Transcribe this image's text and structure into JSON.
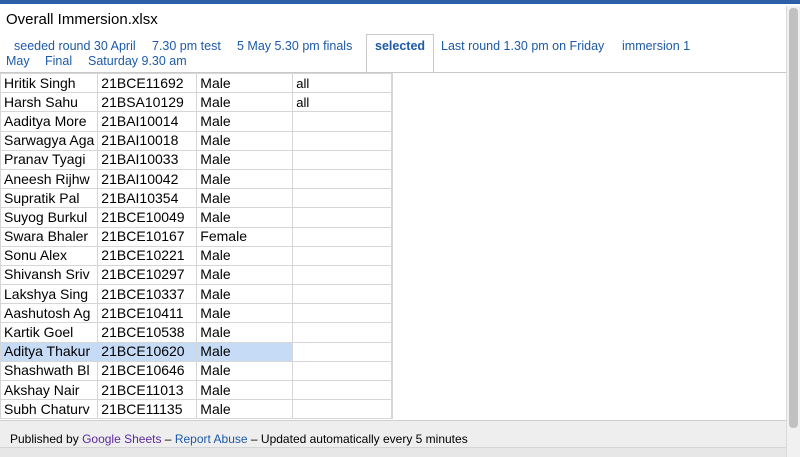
{
  "document": {
    "title": "Overall Immersion.xlsx"
  },
  "tabs": [
    {
      "label": "seeded round 30 April",
      "selected": false
    },
    {
      "label": "7.30 pm test",
      "selected": false
    },
    {
      "label": "5 May 5.30 pm finals",
      "selected": false
    },
    {
      "label": "selected",
      "selected": true
    },
    {
      "label": "Last round 1.30 pm on Friday",
      "selected": false
    },
    {
      "label": "immersion 1",
      "selected": false
    },
    {
      "label": "May",
      "selected": false
    },
    {
      "label": "Final",
      "selected": false
    },
    {
      "label": "Saturday 9.30 am",
      "selected": false
    }
  ],
  "rows": [
    {
      "name": "Hritik Singh",
      "id": "21BCE11692",
      "gender": "Male",
      "note": "all"
    },
    {
      "name": "Harsh Sahu",
      "id": "21BSA10129",
      "gender": "Male",
      "note": "all"
    },
    {
      "name": "Aaditya More",
      "id": "21BAI10014",
      "gender": "Male",
      "note": ""
    },
    {
      "name": "Sarwagya Aga",
      "id": "21BAI10018",
      "gender": "Male",
      "note": ""
    },
    {
      "name": "Pranav Tyagi",
      "id": "21BAI10033",
      "gender": "Male",
      "note": ""
    },
    {
      "name": "Aneesh Rijhw",
      "id": "21BAI10042",
      "gender": "Male",
      "note": ""
    },
    {
      "name": "Supratik Pal",
      "id": "21BAI10354",
      "gender": "Male",
      "note": ""
    },
    {
      "name": "Suyog Burkul",
      "id": "21BCE10049",
      "gender": "Male",
      "note": ""
    },
    {
      "name": "Swara Bhaler",
      "id": "21BCE10167",
      "gender": "Female",
      "note": ""
    },
    {
      "name": "Sonu Alex",
      "id": "21BCE10221",
      "gender": "Male",
      "note": ""
    },
    {
      "name": "Shivansh Sriv",
      "id": "21BCE10297",
      "gender": "Male",
      "note": ""
    },
    {
      "name": "Lakshya Sing",
      "id": "21BCE10337",
      "gender": "Male",
      "note": ""
    },
    {
      "name": "Aashutosh Ag",
      "id": "21BCE10411",
      "gender": "Male",
      "note": ""
    },
    {
      "name": "Kartik Goel",
      "id": "21BCE10538",
      "gender": "Male",
      "note": ""
    },
    {
      "name": "Aditya Thakur",
      "id": "21BCE10620",
      "gender": "Male",
      "note": "",
      "highlighted": true
    },
    {
      "name": "Shashwath Bl",
      "id": "21BCE10646",
      "gender": "Male",
      "note": ""
    },
    {
      "name": "Akshay Nair",
      "id": "21BCE11013",
      "gender": "Male",
      "note": ""
    },
    {
      "name": "Subh Chaturv",
      "id": "21BCE11135",
      "gender": "Male",
      "note": ""
    }
  ],
  "footer": {
    "published_by": "Published by",
    "google_sheets": "Google Sheets",
    "sep1": "–",
    "report_abuse": "Report Abuse",
    "sep2": "–",
    "updated": "Updated automatically every 5 minutes"
  },
  "colors": {
    "link": "#1c5aa8",
    "highlight": "#c6dbf6",
    "top_bar": "#2d5ea8"
  }
}
